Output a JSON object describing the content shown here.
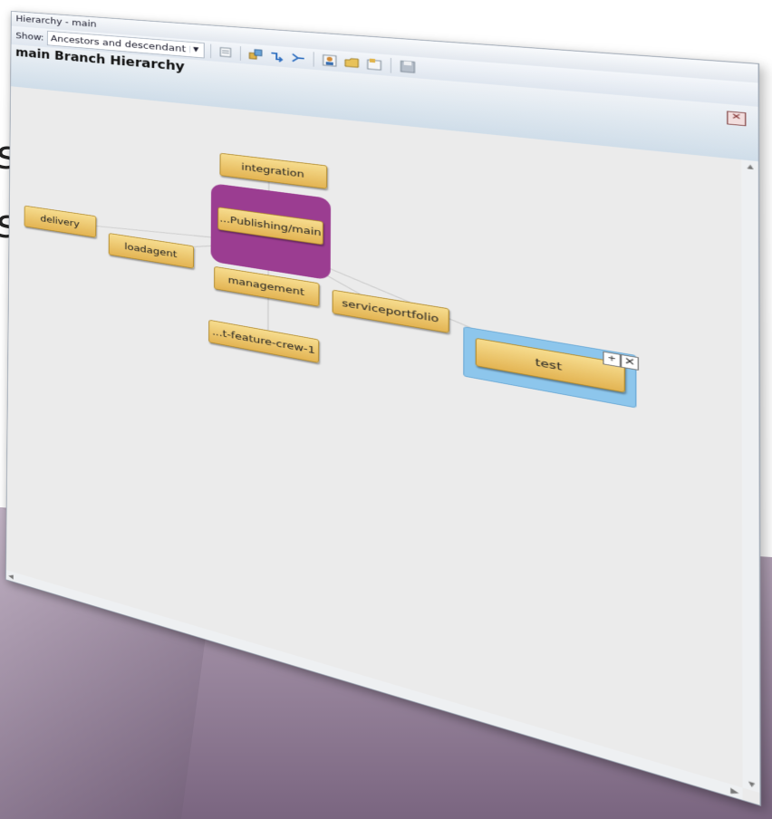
{
  "window": {
    "title": "Hierarchy - main",
    "show_label": "Show:",
    "show_value": "Ancestors and descendant",
    "header_title": "main Branch Hierarchy"
  },
  "toolbar_icons": [
    "layout-icon",
    "branch-properties-icon",
    "merge-icon",
    "merge-to-icon",
    "user-icon",
    "open-icon",
    "properties-icon",
    "save-icon"
  ],
  "slide_glyphs": [
    "s",
    "s"
  ],
  "nodes": {
    "integration": "integration",
    "main": "...Publishing/main",
    "delivery": "delivery",
    "loadagent": "loadagent",
    "management": "management",
    "serviceportfolio": "serviceportfolio",
    "test": "test",
    "feature": "...t-feature-crew-1"
  },
  "node_controls": {
    "expand": "+",
    "close": "✕"
  },
  "colors": {
    "node_fill": "#e8bd5c",
    "focus": "#9b3d91",
    "selected": "#8dc6ec",
    "floor": "#9c8aa0"
  }
}
